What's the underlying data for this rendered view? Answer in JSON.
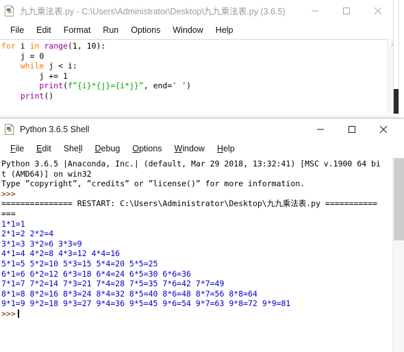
{
  "editor_window": {
    "icon": "python-idle-file-icon",
    "title": "九九乘法表.py - C:\\Users\\Administrator\\Desktop\\九九乘法表.py (3.6.5)",
    "active": false,
    "controls": {
      "minimize": "minimize-icon",
      "maximize": "maximize-icon",
      "close": "close-icon"
    },
    "menu": [
      {
        "label": "File",
        "accel": "F"
      },
      {
        "label": "Edit",
        "accel": "E"
      },
      {
        "label": "Format",
        "accel": "o"
      },
      {
        "label": "Run",
        "accel": "R"
      },
      {
        "label": "Options",
        "accel": "O"
      },
      {
        "label": "Window",
        "accel": "W"
      },
      {
        "label": "Help",
        "accel": "H"
      }
    ],
    "code_lines": [
      [
        {
          "t": "for",
          "c": "kw"
        },
        {
          "t": " i ",
          "c": ""
        },
        {
          "t": "in",
          "c": "kw"
        },
        {
          "t": " ",
          "c": ""
        },
        {
          "t": "range",
          "c": "bi"
        },
        {
          "t": "(1, 10):",
          "c": ""
        }
      ],
      [
        {
          "t": "    j = 0",
          "c": ""
        }
      ],
      [
        {
          "t": "    ",
          "c": ""
        },
        {
          "t": "while",
          "c": "kw"
        },
        {
          "t": " j < i:",
          "c": ""
        }
      ],
      [
        {
          "t": "        j += 1",
          "c": ""
        }
      ],
      [
        {
          "t": "        ",
          "c": ""
        },
        {
          "t": "print",
          "c": "bi"
        },
        {
          "t": "(",
          "c": ""
        },
        {
          "t": "f”{i}*{j}={i*j}”",
          "c": "str"
        },
        {
          "t": ", end=",
          "c": ""
        },
        {
          "t": "’ ’",
          "c": "str"
        },
        {
          "t": ")",
          "c": ""
        }
      ],
      [
        {
          "t": "    ",
          "c": ""
        },
        {
          "t": "print",
          "c": "bi"
        },
        {
          "t": "()",
          "c": ""
        }
      ]
    ]
  },
  "shell_window": {
    "icon": "python-idle-file-icon",
    "title": "Python 3.6.5 Shell",
    "active": true,
    "controls": {
      "minimize": "minimize-icon",
      "maximize": "maximize-icon",
      "close": "close-icon"
    },
    "menu": [
      {
        "label": "File",
        "accel": "F"
      },
      {
        "label": "Edit",
        "accel": "E"
      },
      {
        "label": "Shell",
        "accel": "l"
      },
      {
        "label": "Debug",
        "accel": "D"
      },
      {
        "label": "Options",
        "accel": "O"
      },
      {
        "label": "Window",
        "accel": "W"
      },
      {
        "label": "Help",
        "accel": "H"
      }
    ],
    "shell_lines": [
      [
        {
          "t": "Python 3.6.5 |Anaconda, Inc.| (default, Mar 29 2018, 13:32:41) [MSC v.1900 64 bi",
          "c": ""
        }
      ],
      [
        {
          "t": "t (AMD64)] on win32",
          "c": ""
        }
      ],
      [
        {
          "t": "Type ”copyright”, ”credits” or ”license()” for more information.",
          "c": ""
        }
      ],
      [
        {
          "t": ">>>",
          "c": "prompt"
        }
      ],
      [
        {
          "t": "=============== RESTART: C:\\Users\\Administrator\\Desktop\\九九乘法表.py ===========",
          "c": ""
        }
      ],
      [
        {
          "t": "===",
          "c": ""
        }
      ],
      [
        {
          "t": "1*1=1",
          "c": "out"
        }
      ],
      [
        {
          "t": "2*1=2 2*2=4",
          "c": "out"
        }
      ],
      [
        {
          "t": "3*1=3 3*2=6 3*3=9",
          "c": "out"
        }
      ],
      [
        {
          "t": "4*1=4 4*2=8 4*3=12 4*4=16",
          "c": "out"
        }
      ],
      [
        {
          "t": "5*1=5 5*2=10 5*3=15 5*4=20 5*5=25",
          "c": "out"
        }
      ],
      [
        {
          "t": "6*1=6 6*2=12 6*3=18 6*4=24 6*5=30 6*6=36",
          "c": "out"
        }
      ],
      [
        {
          "t": "7*1=7 7*2=14 7*3=21 7*4=28 7*5=35 7*6=42 7*7=49",
          "c": "out"
        }
      ],
      [
        {
          "t": "8*1=8 8*2=16 8*3=24 8*4=32 8*5=40 8*6=48 8*7=56 8*8=64",
          "c": "out"
        }
      ],
      [
        {
          "t": "9*1=9 9*2=18 9*3=27 9*4=36 9*5=45 9*6=54 9*7=63 9*8=72 9*9=81",
          "c": "out"
        }
      ],
      [
        {
          "t": ">>>",
          "c": "prompt",
          "caret": true
        }
      ]
    ]
  }
}
